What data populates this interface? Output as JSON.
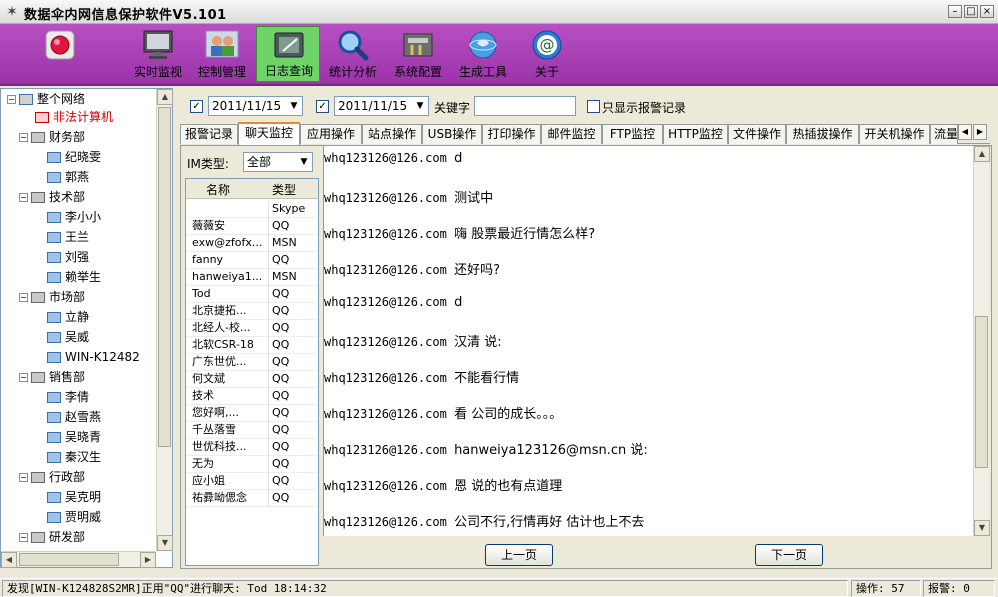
{
  "window": {
    "title": "数据伞内网信息保护软件V5.101"
  },
  "toolbar": {
    "items": [
      {
        "label": ""
      },
      {
        "label": "实时监视"
      },
      {
        "label": "控制管理"
      },
      {
        "label": "日志查询"
      },
      {
        "label": "统计分析"
      },
      {
        "label": "系统配置"
      },
      {
        "label": "生成工具"
      },
      {
        "label": "关于"
      }
    ]
  },
  "tree": {
    "root": "整个网络",
    "illegal": "非法计算机",
    "rows": [
      {
        "label": "财务部"
      },
      {
        "label": "纪晓雯"
      },
      {
        "label": "郭燕"
      },
      {
        "label": "技术部"
      },
      {
        "label": "李小小"
      },
      {
        "label": "王兰"
      },
      {
        "label": "刘强"
      },
      {
        "label": "赖举生"
      },
      {
        "label": "市场部"
      },
      {
        "label": "立静"
      },
      {
        "label": "吴威"
      },
      {
        "label": "WIN-K12482"
      },
      {
        "label": "销售部"
      },
      {
        "label": "李倩"
      },
      {
        "label": "赵雪燕"
      },
      {
        "label": "吴晓青"
      },
      {
        "label": "秦汉生"
      },
      {
        "label": "行政部"
      },
      {
        "label": "吴克明"
      },
      {
        "label": "贾明威"
      },
      {
        "label": "研发部"
      }
    ]
  },
  "filter": {
    "date_from": "2011/11/15",
    "date_to": "2011/11/15",
    "keyword_label": "关键字",
    "keyword_value": "",
    "only_alarm_label": "只显示报警记录"
  },
  "tabs": [
    {
      "label": "报警记录"
    },
    {
      "label": "聊天监控"
    },
    {
      "label": "应用操作"
    },
    {
      "label": "站点操作"
    },
    {
      "label": "USB操作"
    },
    {
      "label": "打印操作"
    },
    {
      "label": "邮件监控"
    },
    {
      "label": "FTP监控"
    },
    {
      "label": "HTTP监控"
    },
    {
      "label": "文件操作"
    },
    {
      "label": "热插拔操作"
    },
    {
      "label": "开关机操作"
    },
    {
      "label": "流量"
    }
  ],
  "im": {
    "type_label": "IM类型:",
    "type_value": "全部",
    "col_name": "名称",
    "col_type": "类型",
    "rows": [
      {
        "name": "",
        "type": "Skype"
      },
      {
        "name": "薇薇安",
        "type": "QQ"
      },
      {
        "name": "exw@zfofx...",
        "type": "MSN"
      },
      {
        "name": "fanny",
        "type": "QQ"
      },
      {
        "name": "hanweiya1...",
        "type": "MSN"
      },
      {
        "name": "Tod",
        "type": "QQ"
      },
      {
        "name": "北京捷拓...",
        "type": "QQ"
      },
      {
        "name": "北经人-校...",
        "type": "QQ"
      },
      {
        "name": "北软CSR-18",
        "type": "QQ"
      },
      {
        "name": "广东世优...",
        "type": "QQ"
      },
      {
        "name": "何文斌",
        "type": "QQ"
      },
      {
        "name": "技术",
        "type": "QQ"
      },
      {
        "name": "您好啊,...",
        "type": "QQ"
      },
      {
        "name": "千丛落雪",
        "type": "QQ"
      },
      {
        "name": "世优科技...",
        "type": "QQ"
      },
      {
        "name": "无为",
        "type": "QQ"
      },
      {
        "name": "应小姐",
        "type": "QQ"
      },
      {
        "name": "祐彛呦偲念",
        "type": "QQ"
      }
    ]
  },
  "chat": {
    "messages": [
      {
        "sender": "whq123126@126.com",
        "text": "d"
      },
      {
        "sender": "whq123126@126.com",
        "text": "测试中"
      },
      {
        "sender": "whq123126@126.com",
        "text": "嗨  股票最近行情怎么样?"
      },
      {
        "sender": "whq123126@126.com",
        "text": "还好吗?"
      },
      {
        "sender": "whq123126@126.com",
        "text": "d"
      },
      {
        "sender": "whq123126@126.com",
        "text": "汉清 说:"
      },
      {
        "sender": "whq123126@126.com",
        "text": "不能看行情"
      },
      {
        "sender": "whq123126@126.com",
        "text": "看 公司的成长。。。"
      },
      {
        "sender": "whq123126@126.com",
        "text": "hanweiya123126@msn.cn 说:"
      },
      {
        "sender": "whq123126@126.com",
        "text": "恩 说的也有点道理"
      },
      {
        "sender": "whq123126@126.com",
        "text": "公司不行,行情再好 估计也上不去"
      }
    ],
    "prev_label": "上一页",
    "next_label": "下一页"
  },
  "status": {
    "message": "发现[WIN-K124828S2MR]正用\"QQ\"进行聊天: Tod  18:14:32",
    "ops": "操作: 57",
    "alarms": "报警: 0"
  }
}
